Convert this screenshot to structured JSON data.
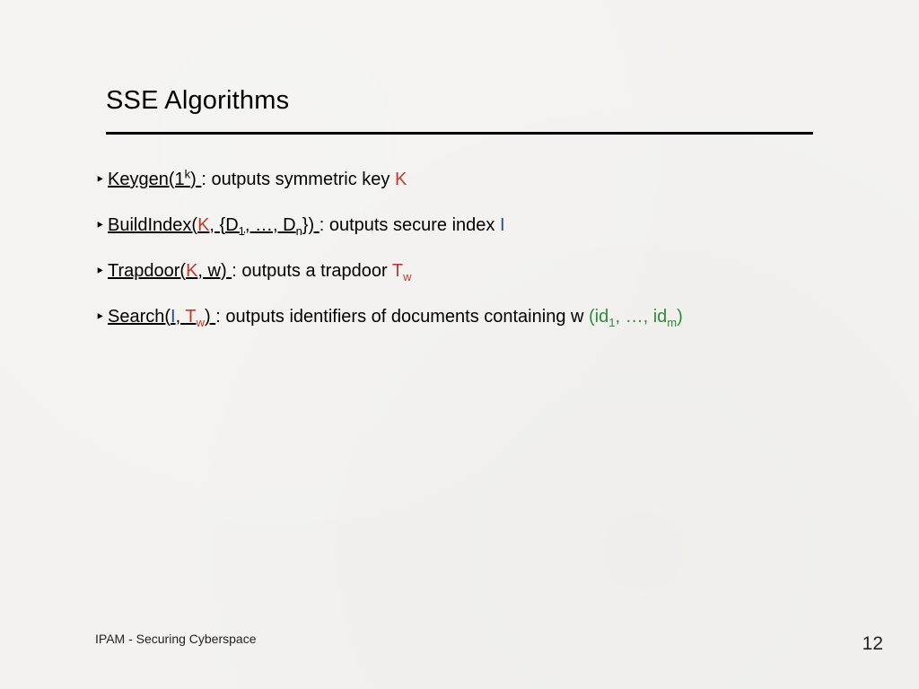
{
  "title": "SSE Algorithms",
  "bullets": {
    "b1": {
      "head_pre": "Keygen(1",
      "head_sup": "k",
      "head_post": ")",
      "body": ": outputs symmetric key ",
      "key": "K"
    },
    "b2": {
      "head_pre": "BuildIndex(",
      "k": "K",
      "sep1": ", {D",
      "d1sub": "1",
      "mid": ", …, D",
      "dnsub": "n",
      "head_post": "})",
      "body": ": outputs secure index ",
      "idx": "I"
    },
    "b3": {
      "head_pre": "Trapdoor(",
      "k": "K",
      "sep": ", w)",
      "body": ": outputs a trapdoor ",
      "tw_t": "T",
      "tw_w": "w"
    },
    "b4": {
      "head_pre": "Search(",
      "i": "I",
      "sep": ", ",
      "tw_t": "T",
      "tw_w": "w",
      "head_post": ")",
      "body": ": outputs identifiers of documents containing w ",
      "ids_open": "(id",
      "id1sub": "1",
      "ids_mid": ", …, id",
      "idmsub": "m",
      "ids_close": ")"
    }
  },
  "footer_left": "IPAM - Securing Cyberspace",
  "footer_right": "12"
}
